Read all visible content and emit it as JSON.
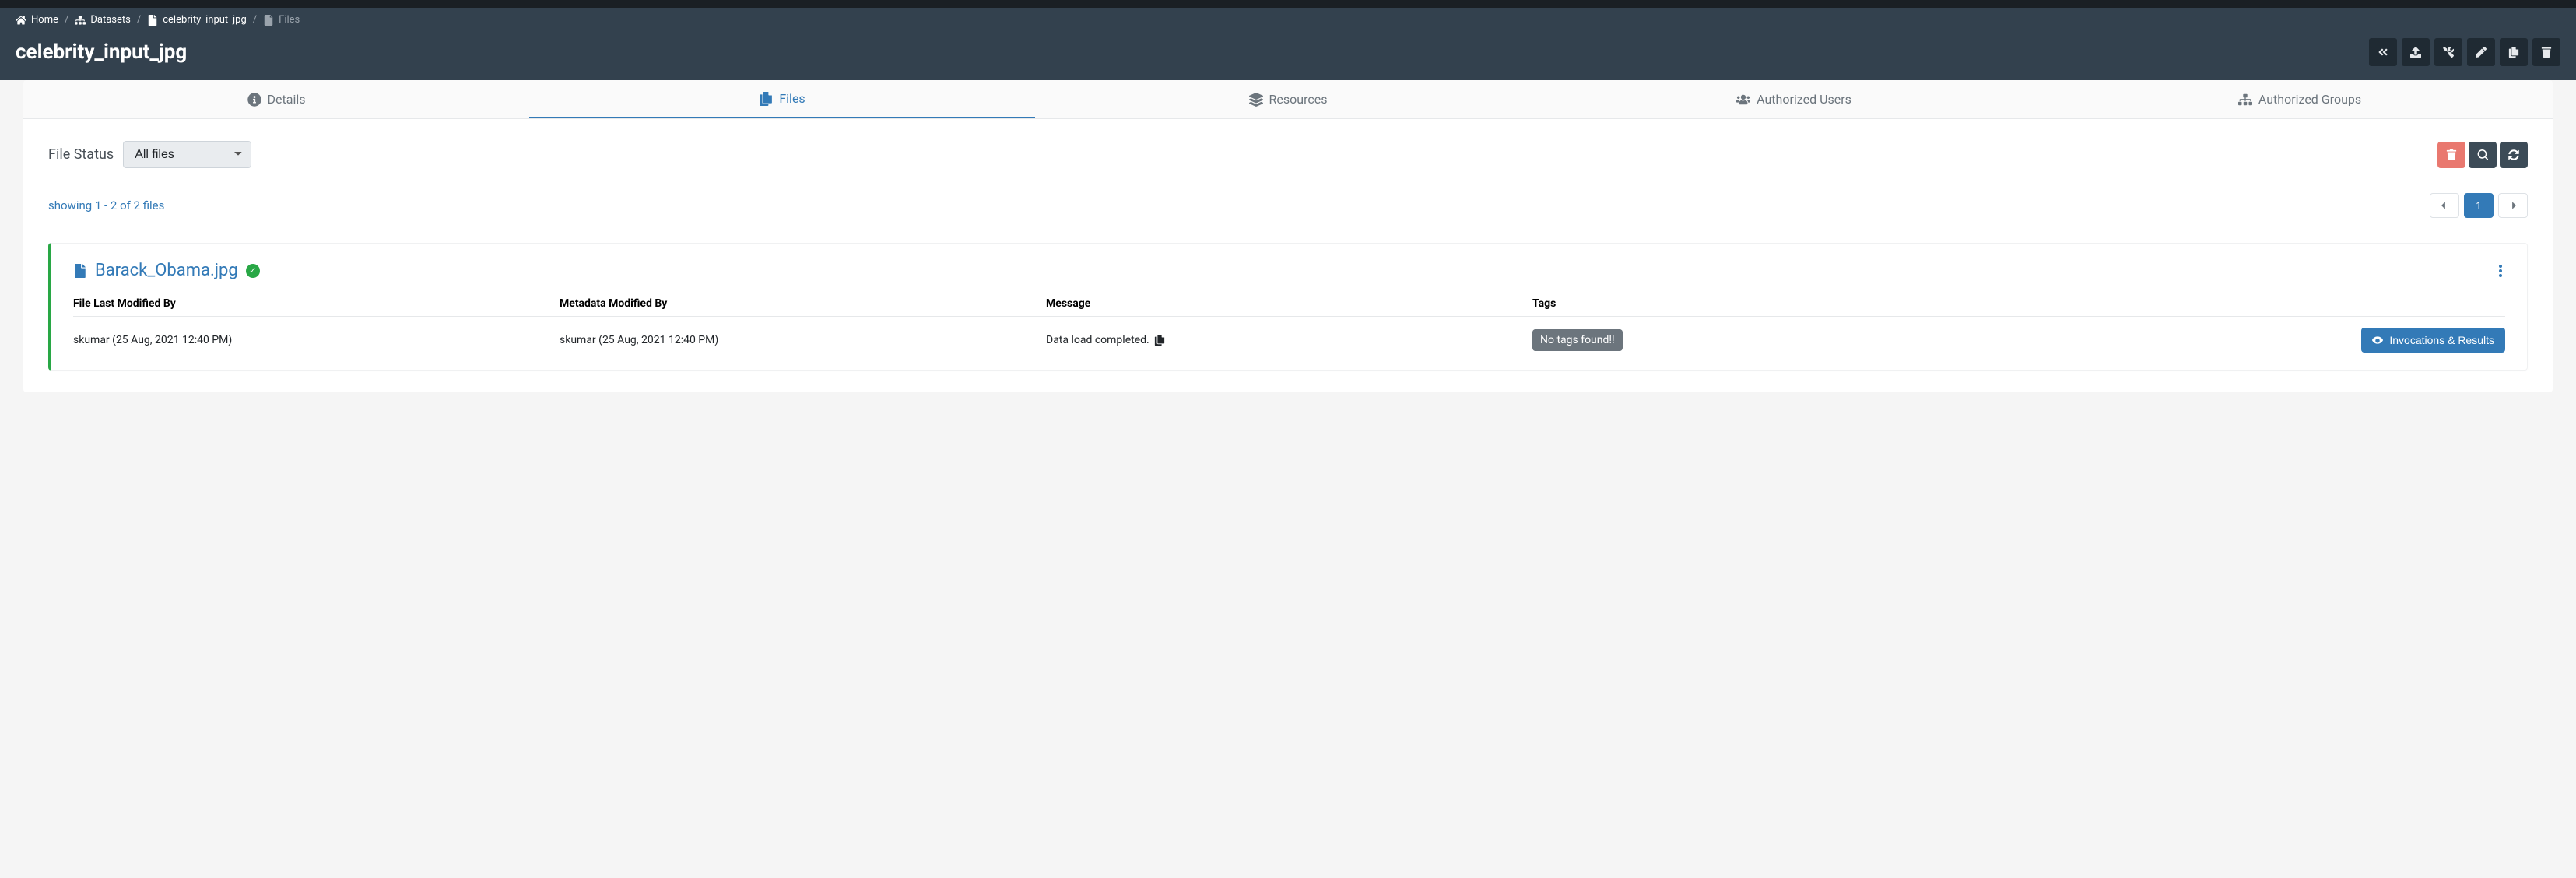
{
  "breadcrumb": {
    "home": "Home",
    "datasets": "Datasets",
    "dataset_name": "celebrity_input_jpg",
    "leaf": "Files"
  },
  "page_title": "celebrity_input_jpg",
  "tabs": {
    "details": "Details",
    "files": "Files",
    "resources": "Resources",
    "auth_users": "Authorized Users",
    "auth_groups": "Authorized Groups"
  },
  "filter": {
    "label": "File Status",
    "selected": "All files"
  },
  "showing": "showing 1 - 2 of 2 files",
  "pager": {
    "current": "1"
  },
  "file": {
    "name": "Barack_Obama.jpg",
    "columns": {
      "file_mod_by": "File Last Modified By",
      "meta_mod_by": "Metadata Modified By",
      "message": "Message",
      "tags": "Tags"
    },
    "values": {
      "file_mod_by": "skumar (25 Aug, 2021 12:40 PM)",
      "meta_mod_by": "skumar (25 Aug, 2021 12:40 PM)",
      "message": "Data load completed.",
      "tags_badge": "No tags found!!"
    },
    "invocations_label": "Invocations & Results"
  }
}
